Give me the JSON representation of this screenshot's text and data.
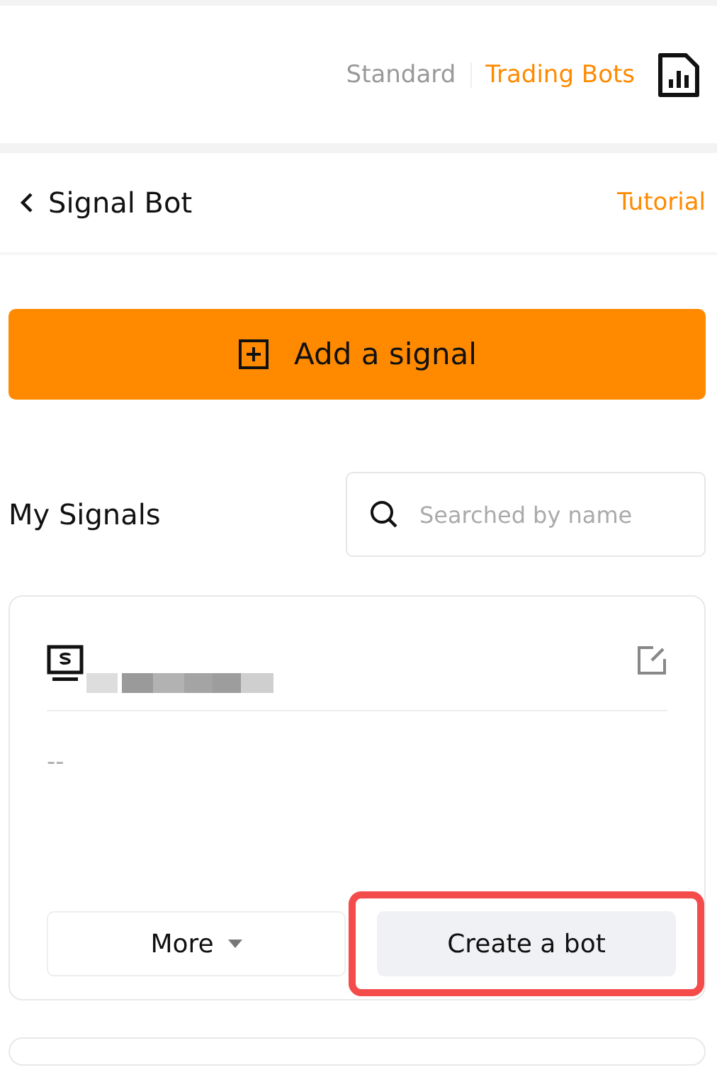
{
  "mode_tabs": [
    {
      "label": "Standard",
      "selected": false
    },
    {
      "label": "Trading Bots",
      "selected": true
    }
  ],
  "header": {
    "title": "Signal Bot",
    "link": "Tutorial"
  },
  "add_button": {
    "label": "Add a signal"
  },
  "signals": {
    "title": "My Signals",
    "search": {
      "placeholder": "Searched by name"
    }
  },
  "cards": [
    {
      "name_redacted": true,
      "description": "--",
      "buttons": [
        {
          "label": "More",
          "kind": "dropdown",
          "highlighted": false
        },
        {
          "label": "Create a bot",
          "kind": "primary",
          "highlighted": true
        }
      ]
    }
  ]
}
